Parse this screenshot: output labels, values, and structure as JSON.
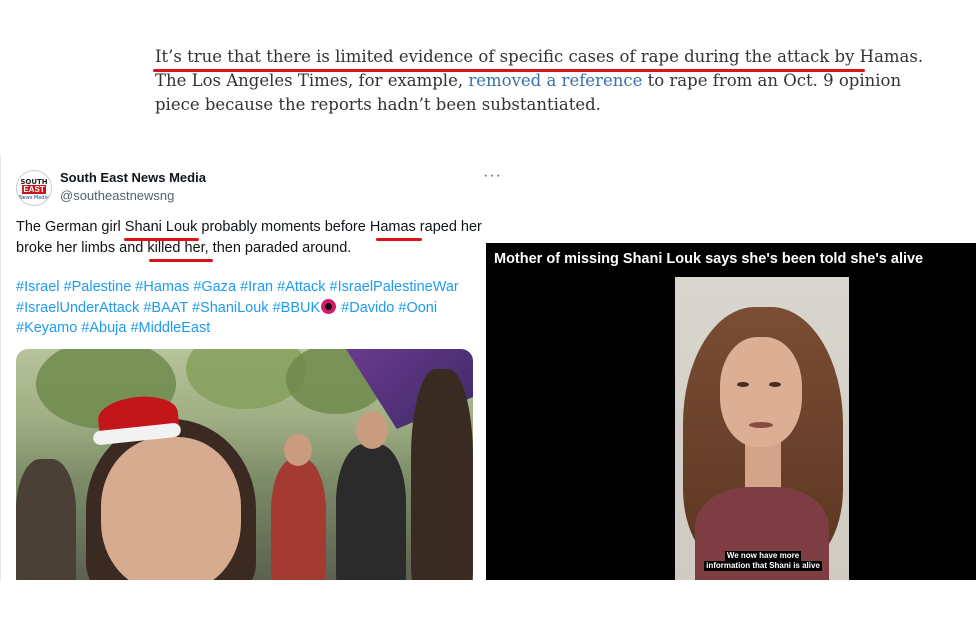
{
  "article": {
    "line1": "It’s true that there is limited evidence of specific cases of rape during the attack by Hamas.",
    "line2_pre": "The Los Angeles Times, for example, ",
    "line2_link": "removed a reference",
    "line2_post": " to rape from an Oct. 9 opinion",
    "line3": "piece because the reports hadn’t been substantiated."
  },
  "tweet": {
    "avatar": {
      "top": "SOUTH",
      "mid": "EAST",
      "bottom": "News Media"
    },
    "display_name": "South East News Media",
    "handle": "@southeastnewsng",
    "more": "···",
    "text": {
      "p1": "The German girl ",
      "name": "Shani Louk",
      "p2": " probably moments before ",
      "hamas": "Hamas",
      "p3": " raped her",
      "p4": "broke her limbs and ",
      "killed": "killed her",
      "p5": ", then paraded around."
    },
    "hashtags": {
      "row1": "#Israel #Palestine #Hamas #Gaza #Iran #Attack #IsraelPalestineWar",
      "row2a": "#IsraelUnderAttack #BAAT #ShaniLouk #BBUK",
      "row2b": " #Davido #Ooni",
      "row3": "#Keyamo #Abuja #MiddleEast"
    },
    "eye_icon": "eye-emoji"
  },
  "video": {
    "title": "Mother of missing Shani Louk says she's been told she's alive",
    "caption1": "We now have more",
    "caption2": "information that Shani is alive"
  },
  "colors": {
    "underline": "#d8131a",
    "link": "#3a6fa8",
    "hashtag": "#1d9bf0",
    "video_bg": "#000000"
  }
}
